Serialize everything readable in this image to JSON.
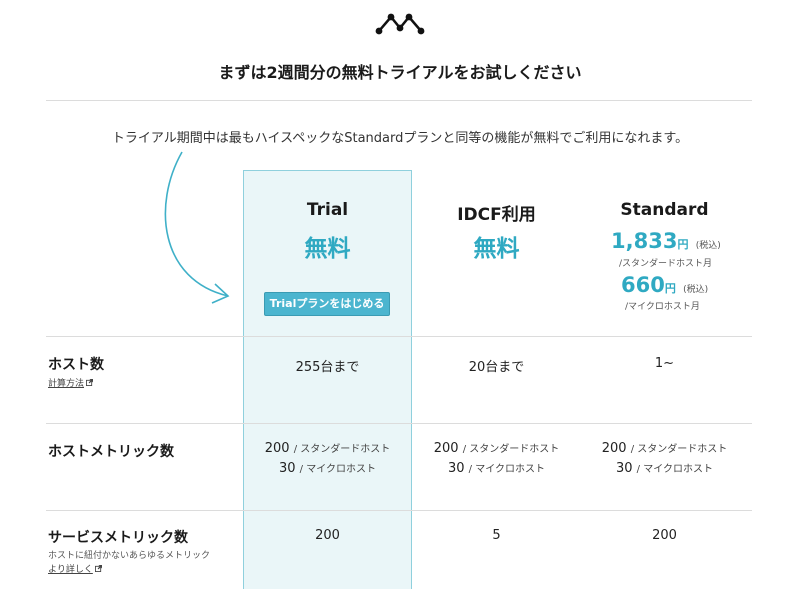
{
  "header": {
    "title": "まずは2週間分の無料トライアルをお試しください",
    "intro": "トライアル期間中は最もハイスペックなStandardプランと同等の機能が無料でご利用になれます。"
  },
  "plans": [
    {
      "name": "Trial",
      "price": "無料",
      "button_label": "Trialプランをはじめる"
    },
    {
      "name": "IDCF利用",
      "price": "無料"
    },
    {
      "name": "Standard",
      "prices": [
        {
          "amount": "1,833",
          "unit": "円",
          "tax": "(税込)",
          "note": "/スタンダードホスト月"
        },
        {
          "amount": "660",
          "unit": "円",
          "tax": "(税込)",
          "note": "/マイクロホスト月"
        }
      ]
    }
  ],
  "rows": [
    {
      "title": "ホスト数",
      "link": "計算方法",
      "values": [
        "255台まで",
        "20台まで",
        "1~"
      ]
    },
    {
      "title": "ホストメトリック数",
      "values": [
        {
          "a_num": "200",
          "a_unit": "/ スタンダードホスト",
          "b_num": "30",
          "b_unit": "/ マイクロホスト"
        },
        {
          "a_num": "200",
          "a_unit": "/ スタンダードホスト",
          "b_num": "30",
          "b_unit": "/ マイクロホスト"
        },
        {
          "a_num": "200",
          "a_unit": "/ スタンダードホスト",
          "b_num": "30",
          "b_unit": "/ マイクロホスト"
        }
      ]
    },
    {
      "title": "サービスメトリック数",
      "subtitle": "ホストに紐付かないあらゆるメトリック",
      "link": "より詳しく",
      "values": [
        "200",
        "5",
        "200"
      ]
    }
  ],
  "colors": {
    "accent": "#2fa9c2",
    "button": "#4bb5cf",
    "trial_bg": "#eaf6f8",
    "trial_border": "#8fd0dd"
  },
  "icons": {
    "logo": "mackerel-logo",
    "arrow": "curved-arrow",
    "external": "external-link-icon"
  }
}
